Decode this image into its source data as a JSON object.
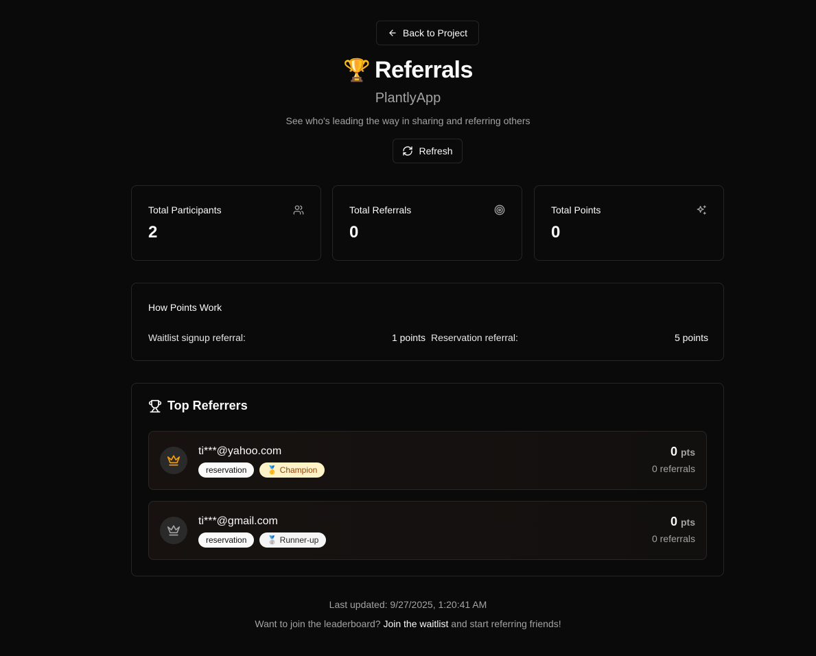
{
  "header": {
    "back_label": "Back to Project",
    "trophy_emoji": "🏆",
    "title": "Referrals",
    "project_name": "PlantlyApp",
    "subtitle": "See who's leading the way in sharing and referring others",
    "refresh_label": "Refresh"
  },
  "stats": [
    {
      "label": "Total Participants",
      "value": "2",
      "icon": "users-icon"
    },
    {
      "label": "Total Referrals",
      "value": "0",
      "icon": "target-icon"
    },
    {
      "label": "Total Points",
      "value": "0",
      "icon": "sparkles-icon"
    }
  ],
  "how_points": {
    "title": "How Points Work",
    "rules": [
      {
        "label": "Waitlist signup referral:",
        "value": "1 points"
      },
      {
        "label": "Reservation referral:",
        "value": "5 points"
      }
    ]
  },
  "top_referrers": {
    "title": "Top Referrers",
    "entries": [
      {
        "email": "ti***@yahoo.com",
        "tag": "reservation",
        "rank_badge": "🥇 Champion",
        "points": "0",
        "points_unit": "pts",
        "referrals": "0 referrals",
        "icon": "crown-gold-icon"
      },
      {
        "email": "ti***@gmail.com",
        "tag": "reservation",
        "rank_badge": "🥈 Runner-up",
        "points": "0",
        "points_unit": "pts",
        "referrals": "0 referrals",
        "icon": "crown-silver-icon"
      }
    ]
  },
  "footer": {
    "last_updated": "Last updated: 9/27/2025, 1:20:41 AM",
    "join_prefix": "Want to join the leaderboard?",
    "join_link": "Join the waitlist",
    "join_suffix": "and start referring friends!"
  },
  "colors": {
    "background": "#0a0a0a",
    "border": "#262626",
    "muted_text": "#a3a3a3",
    "gold_crown": "#f59e0b",
    "silver_crown": "#a3a3a3"
  }
}
